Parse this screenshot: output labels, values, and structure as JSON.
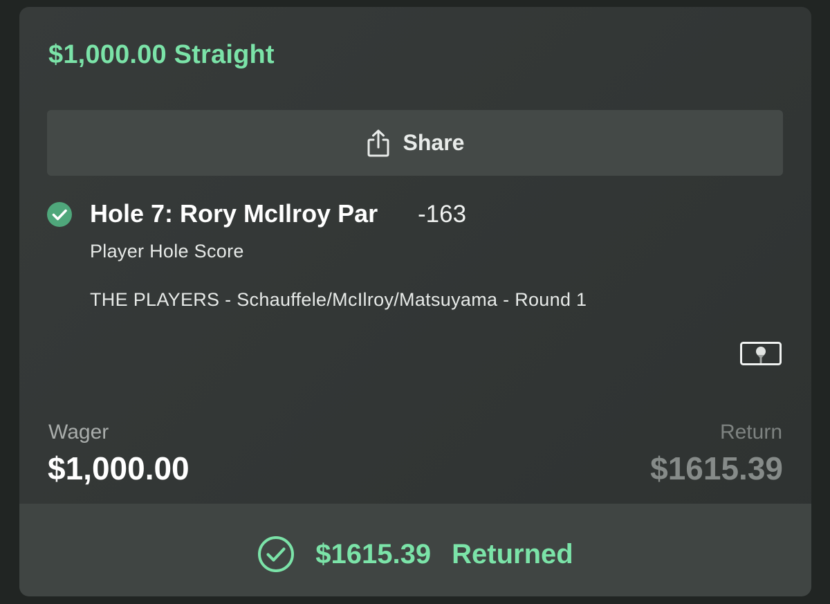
{
  "bet": {
    "title": "$1,000.00 Straight"
  },
  "share": {
    "label": "Share",
    "icon": "share-icon"
  },
  "leg": {
    "status_icon": "check-circle-icon",
    "title": "Hole 7: Rory McIlroy Par",
    "odds": "-163",
    "market": "Player Hole Score",
    "event": "THE PLAYERS - Schauffele/McIlroy/Matsuyama - Round 1",
    "sport_icon": "golf-tee-icon"
  },
  "summary": {
    "wager_label": "Wager",
    "wager_value": "$1,000.00",
    "return_label": "Return",
    "return_value": "$1615.39"
  },
  "footer": {
    "status_icon": "check-circle-outline-icon",
    "amount": "$1615.39",
    "status_text": "Returned"
  },
  "colors": {
    "accent_green": "#7be3a8",
    "check_green": "#4fa77b",
    "card_bg": "#363a39",
    "button_bg": "#444947"
  }
}
